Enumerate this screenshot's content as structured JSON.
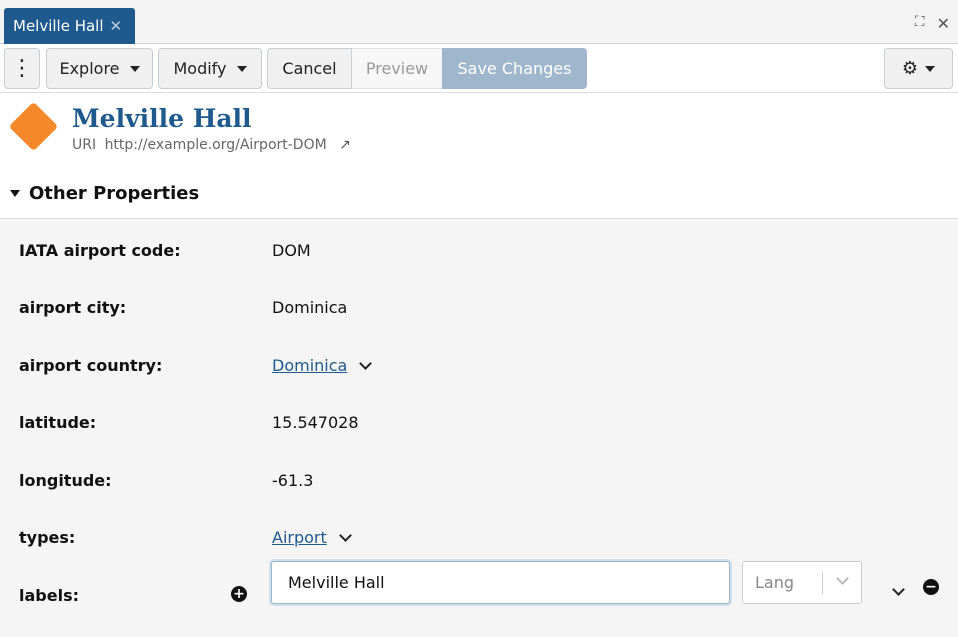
{
  "tab": {
    "title": "Melville Hall",
    "close": "✕"
  },
  "window": {
    "maximize": "⛶",
    "close": "✕"
  },
  "toolbar": {
    "kebab": "⋮",
    "explore": "Explore",
    "modify": "Modify",
    "cancel": "Cancel",
    "preview": "Preview",
    "save": "Save Changes",
    "settings": "⚙"
  },
  "entity": {
    "title": "Melville Hall",
    "uri_prefix": "URI",
    "uri": "http://example.org/Airport-DOM",
    "external_link": "↗"
  },
  "section": {
    "title": "Other Properties"
  },
  "properties": [
    {
      "label": "IATA airport code:",
      "value": "DOM"
    },
    {
      "label": "airport city:",
      "value": "Dominica"
    },
    {
      "label": "airport country:",
      "value": "Dominica"
    },
    {
      "label": "latitude:",
      "value": "15.547028"
    },
    {
      "label": "longitude:",
      "value": "-61.3"
    },
    {
      "label": "types:",
      "value": "Airport"
    },
    {
      "label": "labels:",
      "value": "Melville Hall",
      "lang_placeholder": "Lang",
      "add": "+",
      "remove": "−"
    }
  ],
  "colors": {
    "brand": "#1e5a8e",
    "accent": "#f4882a",
    "save_disabled": "#9fb6cc"
  }
}
